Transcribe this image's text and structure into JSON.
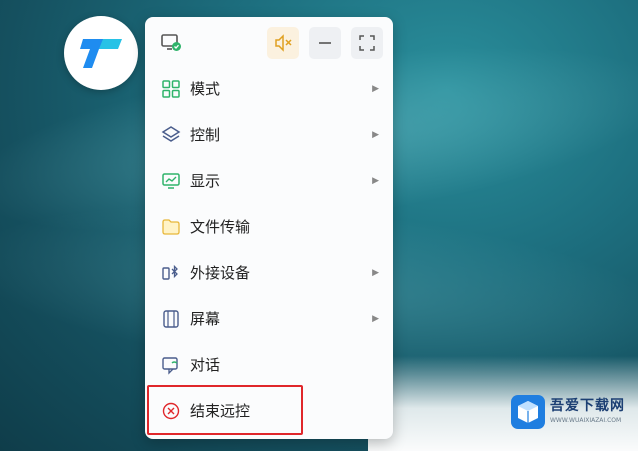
{
  "menu": {
    "items": [
      {
        "label": "模式",
        "icon": "grid-icon",
        "has_submenu": true
      },
      {
        "label": "控制",
        "icon": "layers-icon",
        "has_submenu": true
      },
      {
        "label": "显示",
        "icon": "monitor-chart-icon",
        "has_submenu": true
      },
      {
        "label": "文件传输",
        "icon": "folder-icon",
        "has_submenu": false
      },
      {
        "label": "外接设备",
        "icon": "bluetooth-device-icon",
        "has_submenu": true
      },
      {
        "label": "屏幕",
        "icon": "screen-icon",
        "has_submenu": true
      },
      {
        "label": "对话",
        "icon": "chat-icon",
        "has_submenu": false
      },
      {
        "label": "结束远控",
        "icon": "close-circle-icon",
        "has_submenu": false
      }
    ],
    "submenu_arrow": "▶"
  },
  "toolbar": {
    "icons": [
      "monitor-check-icon",
      "mute-speaker-icon",
      "minimize-icon",
      "fullscreen-icon"
    ]
  },
  "watermark": {
    "title": "吾爱下载网",
    "subtitle": "WWW.WUAIXIAZAI.COM"
  },
  "colors": {
    "highlight_border": "#e0272b",
    "accent_green": "#2fb36b",
    "brand_blue": "#1f8cf0"
  }
}
